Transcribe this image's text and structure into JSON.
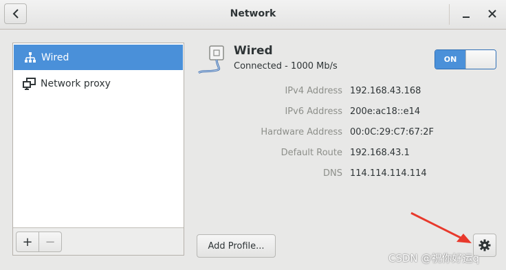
{
  "window": {
    "title": "Network"
  },
  "sidebar": {
    "items": [
      {
        "label": "Wired",
        "icon": "wired-network-icon",
        "selected": true
      },
      {
        "label": "Network proxy",
        "icon": "network-proxy-icon",
        "selected": false
      }
    ],
    "add_label": "+",
    "remove_label": "−"
  },
  "device": {
    "name": "Wired",
    "status": "Connected - 1000 Mb/s",
    "switch_label": "ON",
    "details": [
      {
        "label": "IPv4 Address",
        "value": "192.168.43.168"
      },
      {
        "label": "IPv6 Address",
        "value": "200e:ac18::e14"
      },
      {
        "label": "Hardware Address",
        "value": "00:0C:29:C7:67:2F"
      },
      {
        "label": "Default Route",
        "value": "192.168.43.1"
      },
      {
        "label": "DNS",
        "value": "114.114.114.114"
      }
    ]
  },
  "actions": {
    "add_profile": "Add Profile..."
  },
  "watermark": "CSDN @祝你好运q",
  "colors": {
    "accent": "#4a90d9",
    "arrow": "#e8392c"
  }
}
